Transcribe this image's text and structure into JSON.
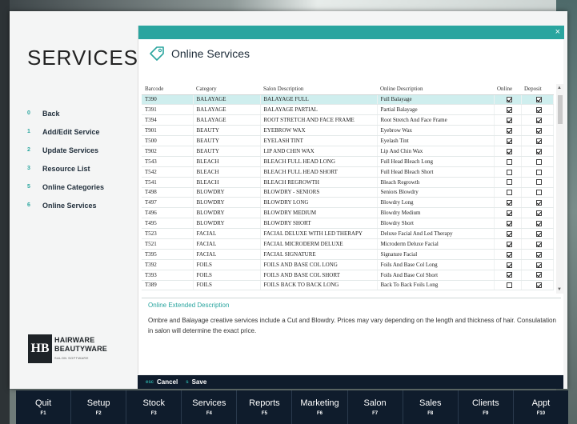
{
  "title": "SERVICES",
  "menu": [
    {
      "key": "0",
      "label": "Back"
    },
    {
      "key": "1",
      "label": "Add/Edit Service"
    },
    {
      "key": "2",
      "label": "Update Services"
    },
    {
      "key": "3",
      "label": "Resource List"
    },
    {
      "key": "5",
      "label": "Online Categories"
    },
    {
      "key": "6",
      "label": "Online Services"
    }
  ],
  "logo": {
    "mark": "HB",
    "line1": "HAIRWARE",
    "line2": "BEAUTYWARE",
    "line3": "SALON SOFTWARE"
  },
  "panel": {
    "title": "Online Services",
    "close": "×"
  },
  "table": {
    "columns": [
      "Barcode",
      "Category",
      "Salon Description",
      "Online Description",
      "Online",
      "Deposit"
    ],
    "rows": [
      {
        "barcode": "T390",
        "category": "BALAYAGE",
        "salon": "BALAYAGE FULL",
        "online": "Full Balayage",
        "on": true,
        "dep": true,
        "selected": true
      },
      {
        "barcode": "T391",
        "category": "BALAYAGE",
        "salon": "BALAYAGE PARTIAL",
        "online": "Partial Balayage",
        "on": true,
        "dep": true
      },
      {
        "barcode": "T394",
        "category": "BALAYAGE",
        "salon": "ROOT STRETCH AND FACE FRAME",
        "online": "Root Stretch And Face Frame",
        "on": true,
        "dep": true
      },
      {
        "barcode": "T901",
        "category": "BEAUTY",
        "salon": "EYEBROW WAX",
        "online": "Eyebrow Wax",
        "on": true,
        "dep": true
      },
      {
        "barcode": "T500",
        "category": "BEAUTY",
        "salon": "EYELASH TINT",
        "online": "Eyelash Tint",
        "on": true,
        "dep": true
      },
      {
        "barcode": "T902",
        "category": "BEAUTY",
        "salon": "LIP AND CHIN WAX",
        "online": "Lip And Chin Wax",
        "on": true,
        "dep": true
      },
      {
        "barcode": "T543",
        "category": "BLEACH",
        "salon": "BLEACH FULL HEAD LONG",
        "online": "Full Head Bleach Long",
        "on": false,
        "dep": false
      },
      {
        "barcode": "T542",
        "category": "BLEACH",
        "salon": "BLEACH FULL HEAD SHORT",
        "online": "Full Head Bleach Short",
        "on": false,
        "dep": false
      },
      {
        "barcode": "T541",
        "category": "BLEACH",
        "salon": "BLEACH REGROWTH",
        "online": "Bleach Regrowth",
        "on": false,
        "dep": false
      },
      {
        "barcode": "T498",
        "category": "BLOWDRY",
        "salon": "BLOWDRY - SENIORS",
        "online": "Seniors Blowdry",
        "on": false,
        "dep": false
      },
      {
        "barcode": "T497",
        "category": "BLOWDRY",
        "salon": "BLOWDRY LONG",
        "online": "Blowdry Long",
        "on": true,
        "dep": true
      },
      {
        "barcode": "T496",
        "category": "BLOWDRY",
        "salon": "BLOWDRY MEDIUM",
        "online": "Blowdry Medium",
        "on": true,
        "dep": true
      },
      {
        "barcode": "T495",
        "category": "BLOWDRY",
        "salon": "BLOWDRY SHORT",
        "online": "Blowdry Short",
        "on": true,
        "dep": true
      },
      {
        "barcode": "T523",
        "category": "FACIAL",
        "salon": "FACIAL DELUXE WITH LED THERAPY",
        "online": "Deluxe Facial And Led Therapy",
        "on": true,
        "dep": true
      },
      {
        "barcode": "T521",
        "category": "FACIAL",
        "salon": "FACIAL MICRODERM DELUXE",
        "online": "Microderm Deluxe Facial",
        "on": true,
        "dep": true
      },
      {
        "barcode": "T395",
        "category": "FACIAL",
        "salon": "FACIAL SIGNATURE",
        "online": "Signature Facial",
        "on": true,
        "dep": true
      },
      {
        "barcode": "T392",
        "category": "FOILS",
        "salon": "FOILS AND BASE COL LONG",
        "online": "Foils And Base Col Long",
        "on": true,
        "dep": true
      },
      {
        "barcode": "T393",
        "category": "FOILS",
        "salon": "FOILS AND BASE COL SHORT",
        "online": "Foils And Base Col Short",
        "on": true,
        "dep": true
      },
      {
        "barcode": "T389",
        "category": "FOILS",
        "salon": "FOILS BACK TO BACK LONG",
        "online": "Back To Back Foils Long",
        "on": false,
        "dep": true
      }
    ]
  },
  "description": {
    "label": "Online Extended Description",
    "text": "Ombre and Balayage creative services include a Cut and Blowdry. Prices may vary depending on the length and thickness of hair. Consulatation in salon will determine the exact price."
  },
  "actions": [
    {
      "key": "esc",
      "label": "Cancel"
    },
    {
      "key": "s",
      "label": "Save"
    }
  ],
  "fkeys": [
    {
      "label": "Quit",
      "key": "F1"
    },
    {
      "label": "Setup",
      "key": "F2"
    },
    {
      "label": "Stock",
      "key": "F3"
    },
    {
      "label": "Services",
      "key": "F4"
    },
    {
      "label": "Reports",
      "key": "F5"
    },
    {
      "label": "Marketing",
      "key": "F6"
    },
    {
      "label": "Salon",
      "key": "F7"
    },
    {
      "label": "Sales",
      "key": "F8"
    },
    {
      "label": "Clients",
      "key": "F9"
    },
    {
      "label": "Appt",
      "key": "F10"
    }
  ],
  "colors": {
    "accent": "#2aa59f",
    "dark": "#0f1c2c",
    "selected_row": "#cfeeee"
  }
}
